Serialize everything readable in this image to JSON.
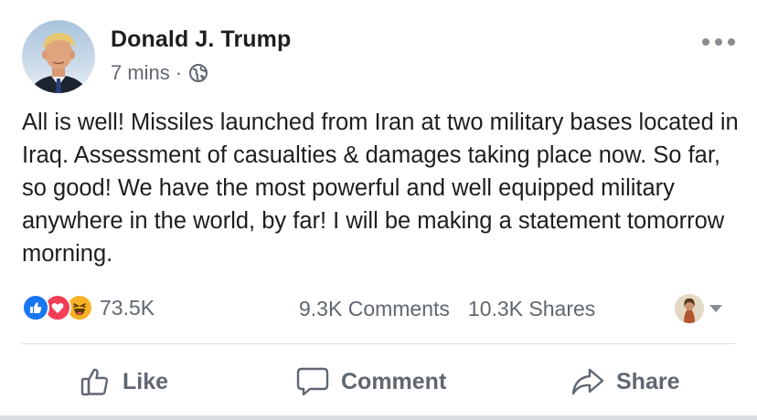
{
  "post": {
    "author": "Donald J. Trump",
    "timestamp": "7 mins",
    "separator": "·",
    "privacy_icon": "globe-icon",
    "menu_icon": "more-horizontal-icon",
    "text": "All is well! Missiles launched from Iran at two military bases located in Iraq. Assessment of casualties & damages taking place now. So far, so good! We have the most powerful and well equipped military anywhere in the world, by far! I will be making a statement tomorrow morning."
  },
  "engagement": {
    "reactions": [
      "like-reaction-icon",
      "love-reaction-icon",
      "haha-reaction-icon"
    ],
    "reaction_count": "73.5K",
    "comments": "9.3K Comments",
    "shares": "10.3K Shares"
  },
  "actions": {
    "like_label": "Like",
    "comment_label": "Comment",
    "share_label": "Share"
  },
  "colors": {
    "text": "#1c1e21",
    "secondary": "#606770",
    "like_blue": "#1877f2",
    "love_red": "#f33e58",
    "haha_yellow": "#f7b125",
    "divider": "#dadde1"
  }
}
